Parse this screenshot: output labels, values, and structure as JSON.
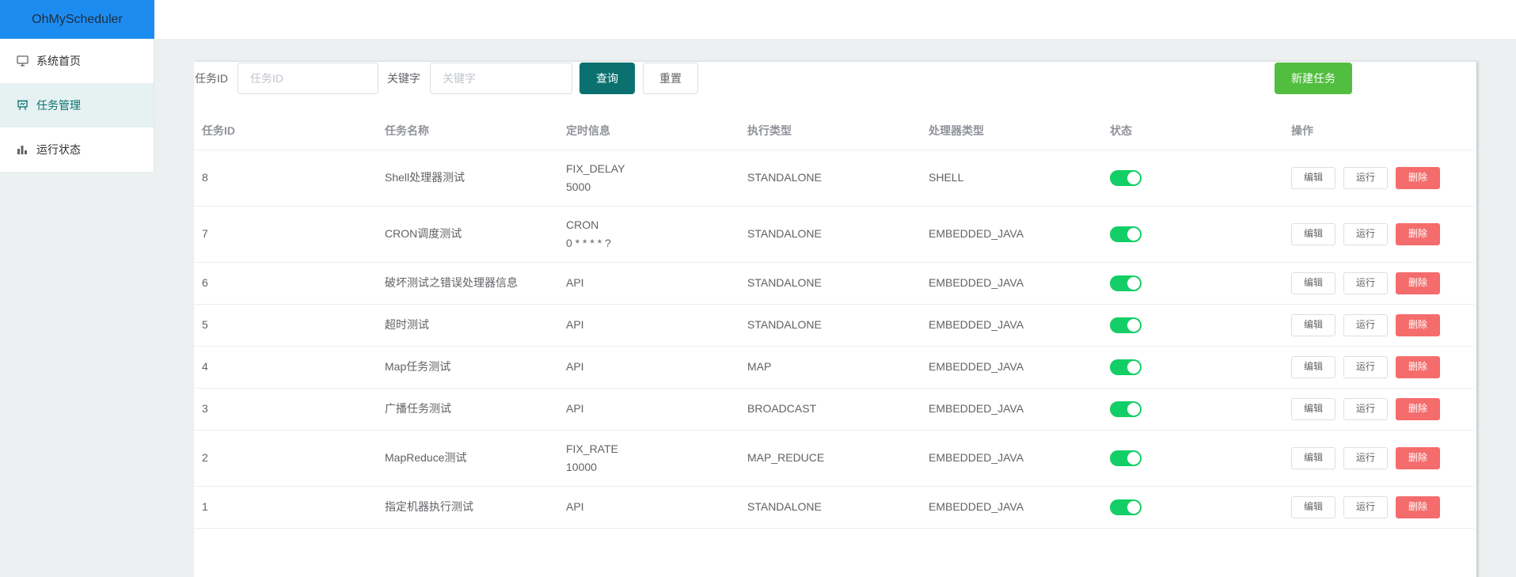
{
  "app": {
    "title": "OhMyScheduler"
  },
  "sidebar": {
    "items": [
      {
        "label": "系统首页",
        "icon": "monitor-icon"
      },
      {
        "label": "任务管理",
        "icon": "presentation-icon"
      },
      {
        "label": "运行状态",
        "icon": "bar-chart-icon"
      }
    ],
    "active": "任务管理"
  },
  "filters": {
    "job_id_label": "任务ID",
    "job_id_placeholder": "任务ID",
    "job_id_value": "",
    "keyword_label": "关键字",
    "keyword_placeholder": "关键字",
    "keyword_value": "",
    "query_label": "查询",
    "reset_label": "重置",
    "new_label": "新建任务"
  },
  "table": {
    "columns": [
      "任务ID",
      "任务名称",
      "定时信息",
      "执行类型",
      "处理器类型",
      "状态",
      "操作"
    ],
    "actions": {
      "edit": "编辑",
      "run": "运行",
      "delete": "删除"
    },
    "rows": [
      {
        "id": "8",
        "name": "Shell处理器测试",
        "time_type": "FIX_DELAY",
        "time_expr": "5000",
        "exec_type": "STANDALONE",
        "processor": "SHELL",
        "enabled": true
      },
      {
        "id": "7",
        "name": "CRON调度测试",
        "time_type": "CRON",
        "time_expr": "0 * * * * ?",
        "exec_type": "STANDALONE",
        "processor": "EMBEDDED_JAVA",
        "enabled": true
      },
      {
        "id": "6",
        "name": "破坏测试之错误处理器信息",
        "time_type": "API",
        "time_expr": "",
        "exec_type": "STANDALONE",
        "processor": "EMBEDDED_JAVA",
        "enabled": true
      },
      {
        "id": "5",
        "name": "超时测试",
        "time_type": "API",
        "time_expr": "",
        "exec_type": "STANDALONE",
        "processor": "EMBEDDED_JAVA",
        "enabled": true
      },
      {
        "id": "4",
        "name": "Map任务测试",
        "time_type": "API",
        "time_expr": "",
        "exec_type": "MAP",
        "processor": "EMBEDDED_JAVA",
        "enabled": true
      },
      {
        "id": "3",
        "name": "广播任务测试",
        "time_type": "API",
        "time_expr": "",
        "exec_type": "BROADCAST",
        "processor": "EMBEDDED_JAVA",
        "enabled": true
      },
      {
        "id": "2",
        "name": "MapReduce测试",
        "time_type": "FIX_RATE",
        "time_expr": "10000",
        "exec_type": "MAP_REDUCE",
        "processor": "EMBEDDED_JAVA",
        "enabled": true
      },
      {
        "id": "1",
        "name": "指定机器执行测试",
        "time_type": "API",
        "time_expr": "",
        "exec_type": "STANDALONE",
        "processor": "EMBEDDED_JAVA",
        "enabled": true
      }
    ]
  },
  "colors": {
    "brand": "#1d8cf0",
    "primary": "#0a7170",
    "success": "#52be3f",
    "switch_on": "#13ce66",
    "danger": "#f56c6c"
  }
}
